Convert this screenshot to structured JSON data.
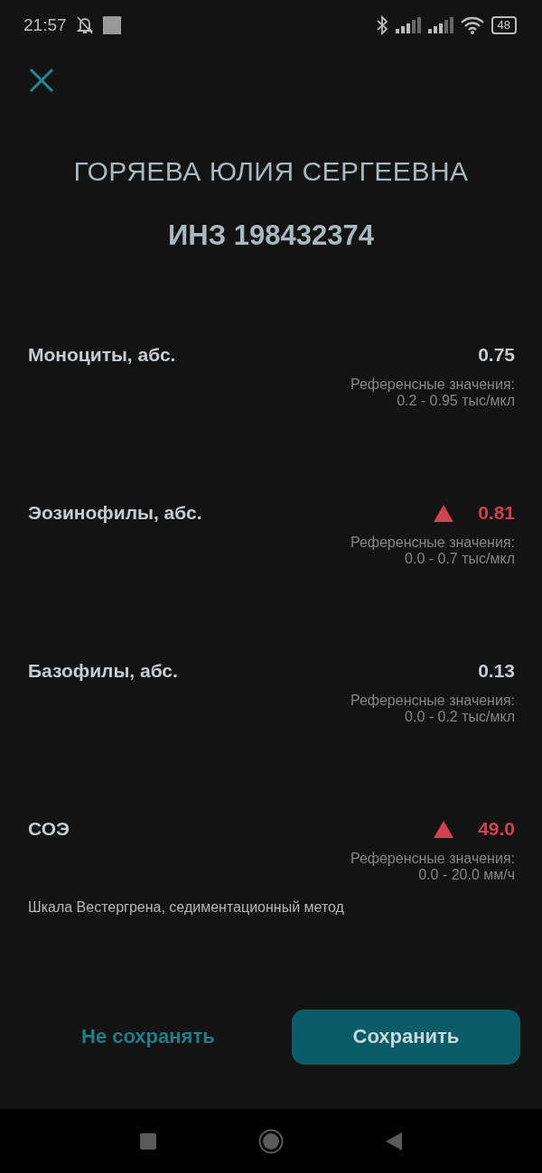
{
  "status_bar": {
    "time": "21:57",
    "battery": "48"
  },
  "patient": {
    "name": "ГОРЯЕВА ЮЛИЯ СЕРГЕЕВНА",
    "id": "ИНЗ 198432374"
  },
  "results": [
    {
      "name": "Моноциты, абс.",
      "value": "0.75",
      "abnormal": false,
      "reference_label": "Референсные значения:",
      "reference_range": "0.2 - 0.95 тыс/мкл"
    },
    {
      "name": "Эозинофилы, абс.",
      "value": "0.81",
      "abnormal": true,
      "reference_label": "Референсные значения:",
      "reference_range": "0.0 - 0.7 тыс/мкл"
    },
    {
      "name": "Базофилы, абс.",
      "value": "0.13",
      "abnormal": false,
      "reference_label": "Референсные значения:",
      "reference_range": "0.0 - 0.2 тыс/мкл"
    },
    {
      "name": "СОЭ",
      "value": "49.0",
      "abnormal": true,
      "reference_label": "Референсные значения:",
      "reference_range": "0.0 - 20.0 мм/ч",
      "note": "Шкала Вестергрена, седиментационный метод"
    }
  ],
  "buttons": {
    "cancel": "Не сохранять",
    "save": "Сохранить"
  }
}
